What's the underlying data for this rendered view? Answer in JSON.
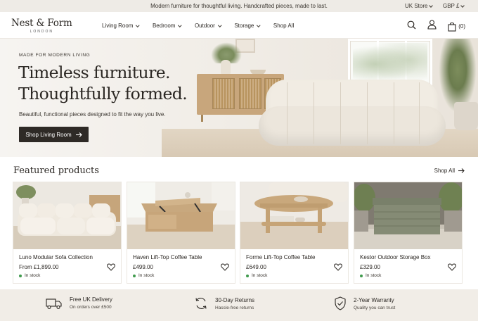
{
  "announcement": {
    "message": "Modern furniture for thoughtful living. Handcrafted pieces, made to last.",
    "store": "UK Store",
    "currency": "GBP £"
  },
  "brand": {
    "name": "Nest & Form",
    "location": "LONDON"
  },
  "nav": {
    "items": [
      {
        "label": "Living Room",
        "has_dropdown": true
      },
      {
        "label": "Bedroom",
        "has_dropdown": true
      },
      {
        "label": "Outdoor",
        "has_dropdown": true
      },
      {
        "label": "Storage",
        "has_dropdown": true
      },
      {
        "label": "Shop All",
        "has_dropdown": false
      }
    ]
  },
  "header_icons": {
    "search": "search-icon",
    "account": "user-icon",
    "cart": "bag-icon",
    "cart_count": "(0)"
  },
  "hero": {
    "eyebrow": "MADE FOR MODERN LIVING",
    "headline_line1": "Timeless furniture.",
    "headline_line2": "Thoughtfully formed.",
    "lead": "Beautiful, functional pieces designed to fit the way you live.",
    "cta": "Shop Living Room"
  },
  "featured": {
    "title": "Featured products",
    "shop_all": "Shop All",
    "products": [
      {
        "name": "Luno Modular Sofa Collection",
        "price": "From £1,899.00",
        "stock": "In stock"
      },
      {
        "name": "Haven Lift-Top Coffee Table",
        "price": "£499.00",
        "stock": "In stock"
      },
      {
        "name": "Forme Lift-Top Coffee Table",
        "price": "£649.00",
        "stock": "In stock"
      },
      {
        "name": "Kestor Outdoor Storage Box",
        "price": "£329.00",
        "stock": "In stock"
      }
    ]
  },
  "benefits": [
    {
      "icon": "truck-icon",
      "title": "Free UK Delivery",
      "subtitle": "On orders over £500"
    },
    {
      "icon": "returns-icon",
      "title": "30-Day Returns",
      "subtitle": "Hassle-free returns"
    },
    {
      "icon": "shield-check-icon",
      "title": "2-Year Warranty",
      "subtitle": "Quality you can trust"
    }
  ],
  "colors": {
    "dark": "#2e2a26",
    "beige": "#f1ede7",
    "in_stock": "#3f9a4c"
  }
}
